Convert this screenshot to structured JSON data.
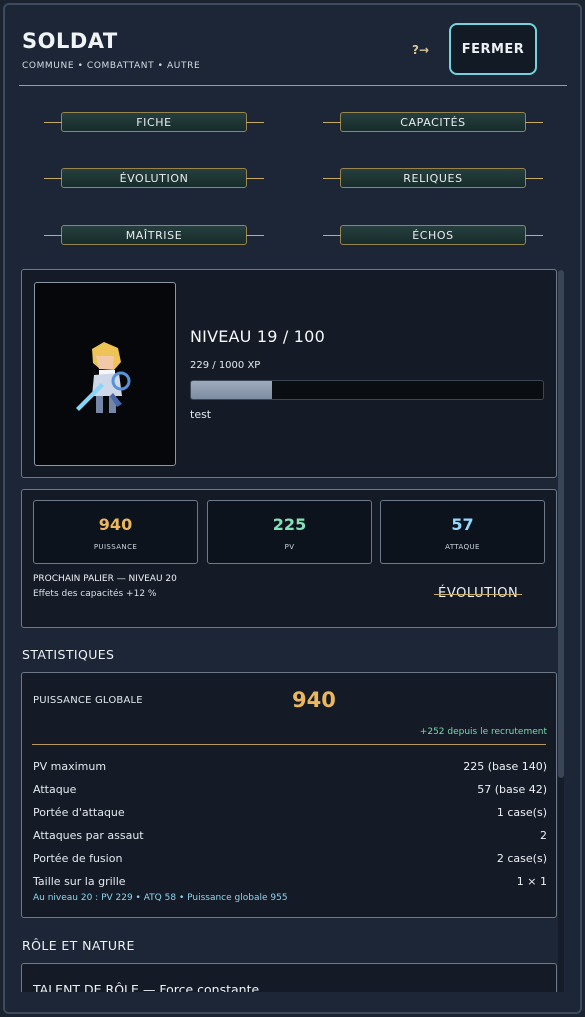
{
  "header": {
    "title": "SOLDAT",
    "subtitle": "COMMUNE • COMBATTANT • AUTRE",
    "help_label": "?→",
    "close_label": "FERMER"
  },
  "tabs": [
    {
      "label": "FICHE"
    },
    {
      "label": "CAPACITÉS"
    },
    {
      "label": "ÉVOLUTION"
    },
    {
      "label": "RELIQUES"
    },
    {
      "label": "MAÎTRISE"
    },
    {
      "label": "ÉCHOS"
    }
  ],
  "hero": {
    "level": "NIVEAU 19 / 100",
    "xp_text": "229 / 1000 XP",
    "xp_progress": 0.229,
    "description": "test",
    "portrait_icon": "soldier-sprite"
  },
  "stats": [
    {
      "value": "940",
      "label": "PUISSANCE",
      "color": "#ebb65d"
    },
    {
      "value": "225",
      "label": "PV",
      "color": "#83e1b8"
    },
    {
      "value": "57",
      "label": "ATTAQUE",
      "color": "#93d9ff"
    }
  ],
  "next_tier": {
    "title": "PROCHAIN PALIER — NIVEAU 20",
    "effect": "Effets des capacités +12 %"
  },
  "evolve_label": "ÉVOLUTION",
  "sections": {
    "stats_title": "STATISTIQUES",
    "role_title": "RÔLE ET NATURE"
  },
  "global_power": {
    "label": "PUISSANCE GLOBALE",
    "value": "940",
    "delta": "+252 depuis le recrutement"
  },
  "stat_rows": [
    {
      "label": "PV maximum",
      "value": "225  (base 140)"
    },
    {
      "label": "Attaque",
      "value": "57  (base 42)"
    },
    {
      "label": "Portée d'attaque",
      "value": "1 case(s)"
    },
    {
      "label": "Attaques par assaut",
      "value": "2"
    },
    {
      "label": "Portée de fusion",
      "value": "2 case(s)"
    },
    {
      "label": "Taille sur la grille",
      "value": "1 × 1"
    }
  ],
  "forecast": "Au niveau 20 : PV 229  •  ATQ 58  •  Puissance globale 955",
  "talent": {
    "title": "TALENT DE RÔLE — Force constante"
  }
}
